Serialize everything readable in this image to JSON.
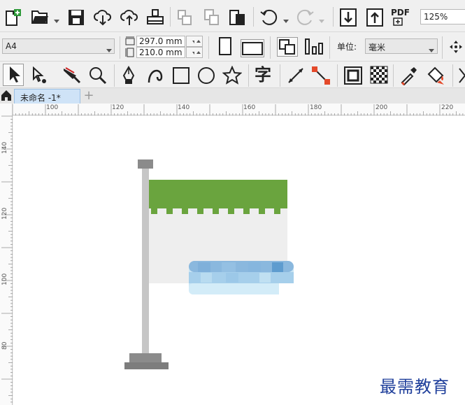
{
  "standard_toolbar": {
    "icons": [
      "new-document-icon",
      "open-folder-icon",
      "save-icon",
      "cloud-download-icon",
      "cloud-upload-icon",
      "print-icon",
      "copy-properties-icon",
      "paste-icon",
      "clipboard-icon",
      "undo-icon",
      "redo-icon",
      "import-icon",
      "export-icon",
      "pdf-icon"
    ],
    "pdf_label": "PDF",
    "zoom_level": "125%"
  },
  "property_bar": {
    "paper_size": "A4",
    "width_value": "297.0 mm",
    "height_value": "210.0 mm",
    "unit_label": "单位:",
    "unit_value": "毫米"
  },
  "toolbox": {
    "tools": [
      "pick-tool-icon",
      "shape-tool-icon",
      "knife-tool-icon",
      "zoom-tool-icon",
      "pen-tool-icon",
      "bezier-tool-icon",
      "rectangle-tool-icon",
      "ellipse-tool-icon",
      "star-tool-icon",
      "text-tool-icon",
      "dimension-tool-icon",
      "connector-tool-icon",
      "shadow-tool-icon",
      "transparency-tool-icon",
      "eyedropper-tool-icon",
      "fill-tool-icon"
    ],
    "text_tool_glyph": "字"
  },
  "tabs": {
    "document_tab": "未命名 -1*",
    "new_tab": "+"
  },
  "ruler": {
    "horizontal_ticks": [
      "100",
      "120",
      "140",
      "160",
      "180",
      "200",
      "220"
    ],
    "vertical_ticks": [
      "140",
      "120",
      "100",
      "80"
    ]
  },
  "watermark": "最需教育",
  "colors": {
    "flag_green": "#6aa43e",
    "flag_white": "#eeeeee",
    "pole_gray": "#c6c6c6",
    "base_gray": "#8b8b8b",
    "pixel_blue": "#8ab8de",
    "doc_tab_bg": "#cfe3f7"
  }
}
